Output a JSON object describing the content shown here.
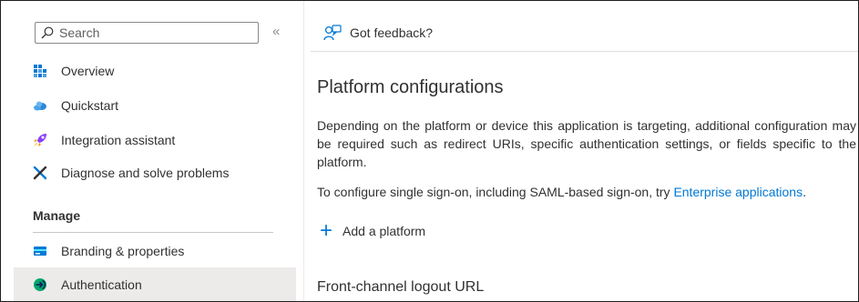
{
  "sidebar": {
    "search_placeholder": "Search",
    "collapse_glyph": "«",
    "items": [
      {
        "label": "Overview",
        "icon": "overview-grid-icon"
      },
      {
        "label": "Quickstart",
        "icon": "cloud-icon"
      },
      {
        "label": "Integration assistant",
        "icon": "rocket-icon"
      },
      {
        "label": "Diagnose and solve problems",
        "icon": "wrench-cross-icon"
      }
    ],
    "section": "Manage",
    "manage_items": [
      {
        "label": "Branding & properties",
        "icon": "branding-icon"
      },
      {
        "label": "Authentication",
        "icon": "authentication-icon",
        "active": true
      }
    ]
  },
  "toolbar": {
    "feedback_label": "Got feedback?",
    "feedback_icon": "feedback-person-icon"
  },
  "main": {
    "heading": "Platform configurations",
    "description": "Depending on the platform or device this application is targeting, additional configuration may be required such as redirect URIs, specific authentication settings, or fields specific to the platform.",
    "sso_prefix": "To configure single sign-on, including SAML-based sign-on, try ",
    "sso_link": "Enterprise applications",
    "sso_suffix": ".",
    "add_platform_label": "Add a platform",
    "front_channel_heading": "Front-channel logout URL"
  },
  "colors": {
    "accent": "#0078d4",
    "active_bg": "#edebe9",
    "text": "#323130"
  }
}
